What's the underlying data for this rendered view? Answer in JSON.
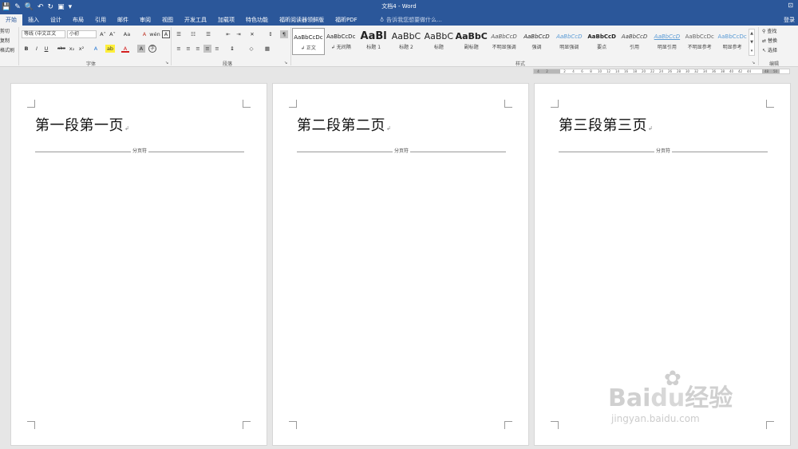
{
  "window": {
    "title": "文档4 - Word",
    "quick_access": [
      "💾",
      "✎",
      "🔍",
      "↶",
      "↻",
      "▣",
      "▾"
    ],
    "controls": "⊡"
  },
  "tabs": {
    "items": [
      "开始",
      "插入",
      "设计",
      "布局",
      "引用",
      "邮件",
      "审阅",
      "视图",
      "开发工具",
      "加载项",
      "特色功能",
      "福昕阅读器领鲜版",
      "福昕PDF"
    ],
    "active": "开始",
    "tell_me": "告诉我您想要做什么...",
    "login": "登录"
  },
  "clipboard": {
    "cut": "剪切",
    "copy": "复制",
    "format_painter": "格式刷"
  },
  "font": {
    "family": "等线 (中文正文",
    "size": "小初",
    "grow": "A˄",
    "shrink": "A˅",
    "case": "Aa",
    "clear": "A",
    "phonetic": "wén",
    "border": "A",
    "bold": "B",
    "italic": "I",
    "underline": "U",
    "strike": "abc",
    "sub": "x₂",
    "sup": "x²",
    "effects": "A",
    "highlight": "ab",
    "color": "A",
    "shade": "A",
    "circle": "字",
    "group_label": "字体"
  },
  "paragraph": {
    "bullets": "☰",
    "numbering": "☷",
    "multilevel": "☰",
    "decrease_indent": "⇤",
    "increase_indent": "⇥",
    "asian_layout": "✕",
    "sort": "↕",
    "show_marks": "¶",
    "align_left": "≡",
    "align_center": "≡",
    "align_right": "≡",
    "justify": "≡",
    "distribute": "≡",
    "line_spacing": "↨",
    "shading": "◇",
    "borders": "▦",
    "group_label": "段落"
  },
  "styles": {
    "items": [
      {
        "preview": "AaBbCcDc",
        "name": "↲ 正文"
      },
      {
        "preview": "AaBbCcDc",
        "name": "↲ 无间隔"
      },
      {
        "preview": "AaBl",
        "name": "标题 1"
      },
      {
        "preview": "AaBbC",
        "name": "标题 2"
      },
      {
        "preview": "AaBbC",
        "name": "标题"
      },
      {
        "preview": "AaBbC",
        "name": "副标题"
      },
      {
        "preview": "AaBbCcD",
        "name": "不明显强调"
      },
      {
        "preview": "AaBbCcD",
        "name": "强调"
      },
      {
        "preview": "AaBbCcD",
        "name": "明显强调"
      },
      {
        "preview": "AaBbCcD",
        "name": "要点"
      },
      {
        "preview": "AaBbCcD",
        "name": "引用"
      },
      {
        "preview": "AaBbCcD",
        "name": "明显引用"
      },
      {
        "preview": "AaBbCcDc",
        "name": "不明显参考"
      },
      {
        "preview": "AaBbCcDc",
        "name": "明显参考"
      }
    ],
    "group_label": "样式"
  },
  "editing": {
    "find": "查找",
    "replace": "替换",
    "select": "选择",
    "group_label": "编辑"
  },
  "ruler": [
    "4",
    "2",
    "",
    "2",
    "4",
    "6",
    "8",
    "10",
    "12",
    "14",
    "16",
    "18",
    "20",
    "22",
    "24",
    "26",
    "28",
    "30",
    "32",
    "34",
    "36",
    "38",
    "40",
    "42",
    "44",
    "",
    "48",
    "50"
  ],
  "pages": [
    {
      "heading": "第一段第一页",
      "break_label": "分页符"
    },
    {
      "heading": "第二段第二页",
      "break_label": "分页符"
    },
    {
      "heading": "第三段第三页",
      "break_label": "分页符"
    }
  ],
  "watermark": {
    "logo_a": "Bai",
    "logo_b": "du",
    "logo_c": "经验",
    "url": "jingyan.baidu.com"
  },
  "colors": {
    "brand": "#2b579a",
    "ribbon": "#f3f3f3",
    "canvas": "#e6e6e6"
  }
}
